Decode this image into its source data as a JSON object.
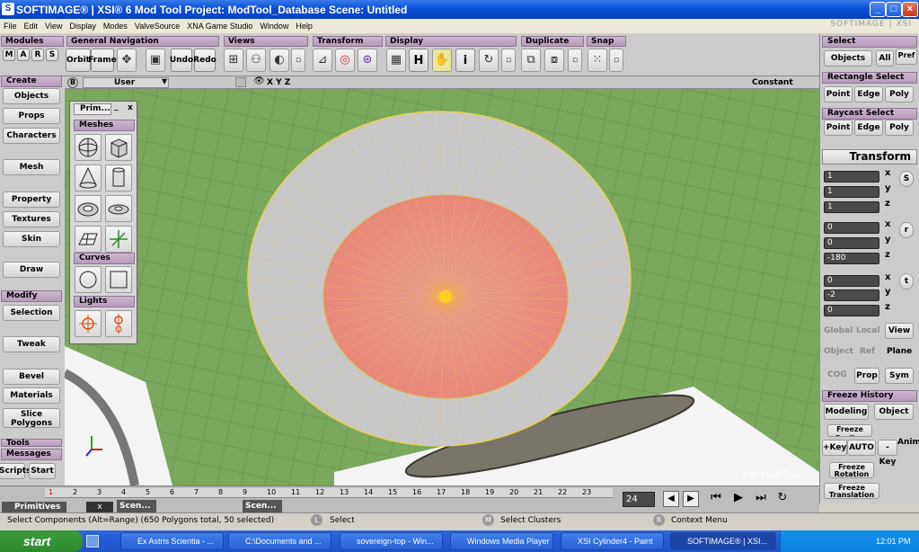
{
  "window": {
    "title": "SOFTIMAGE® | XSI® 6 Mod Tool Project: ModTool_Database     Scene: Untitled",
    "brand": "SOFTIMAGE | XSI"
  },
  "menu": [
    "File",
    "Edit",
    "View",
    "Display",
    "Modes",
    "ValveSource",
    "XNA Game Studio",
    "Window",
    "Help"
  ],
  "toolbar": {
    "modules": {
      "label": "Modules",
      "items": [
        "M",
        "A",
        "R",
        "S"
      ]
    },
    "general_nav": {
      "label": "General Navigation",
      "items": [
        "Orbit",
        "Frame"
      ]
    },
    "views": {
      "label": "Views"
    },
    "transform": {
      "label": "Transform",
      "undo": "Undo",
      "redo": "Redo"
    },
    "display": {
      "label": "Display",
      "h": "H",
      "i": "i"
    },
    "duplicate": {
      "label": "Duplicate"
    },
    "snap": {
      "label": "Snap"
    }
  },
  "left_panel": {
    "create_header": "Create",
    "create_items": [
      "Objects",
      "Props",
      "Characters",
      "Mesh",
      "Property",
      "Textures",
      "Skin",
      "Draw"
    ],
    "modify_header": "Modify",
    "modify_items": [
      "Selection",
      "Tweak",
      "Bevel",
      "Materials",
      "Slice Polygons"
    ],
    "tools_header": "Tools",
    "messages_header": "Messages",
    "bottom_items": [
      "Scripts",
      "Start"
    ]
  },
  "viewport_bar": {
    "b": "B",
    "camera": "User",
    "axes": "X  Y  Z",
    "mode": "Constant"
  },
  "primitives": {
    "title": "Prim...",
    "meshes": "Meshes",
    "curves": "Curves",
    "lights": "Lights"
  },
  "watermark": "XSI Mod Tool",
  "right_panel": {
    "select_header": "Select",
    "objects": "Objects",
    "all": "All",
    "pref": "Pref",
    "rect_select": "Rectangle Select",
    "raycast_select": "Raycast Select",
    "point": "Point",
    "edge": "Edge",
    "poly": "Poly",
    "transform_header": "Transform",
    "scale": [
      "1",
      "1",
      "1"
    ],
    "rotate": [
      "0",
      "0",
      "-180"
    ],
    "translate": [
      "0",
      "-2",
      "0"
    ],
    "axes": [
      "x",
      "y",
      "z"
    ],
    "srt": [
      "S",
      "r",
      "t"
    ],
    "global": "Global",
    "local": "Local",
    "view": "View",
    "object": "Object",
    "ref": "Ref",
    "plane": "Plane",
    "cog": "COG",
    "prop": "Prop",
    "sym": "Sym",
    "freeze_header": "Freeze History",
    "modeling": "Modeling",
    "object_btn": "Object",
    "freeze_scaling": "Freeze Scaling",
    "key": "+Key",
    "auto": "AUTO",
    "minus_key": "-Key",
    "anim": "Anim",
    "freeze_rotation": "Freeze Rotation",
    "freeze_translation": "Freeze Translation"
  },
  "timeline": {
    "frames": [
      "1",
      "2",
      "3",
      "4",
      "5",
      "6",
      "7",
      "8",
      "9",
      "10",
      "11",
      "12",
      "13",
      "14",
      "15",
      "16",
      "17",
      "18",
      "19",
      "20",
      "21",
      "22",
      "23"
    ],
    "current": "24",
    "primitives": "Primitives",
    "scene1": "Scen...",
    "scene2": "Scen..."
  },
  "status": {
    "message": "Select Components (Alt=Range) (650 Polygons total, 50 selected)",
    "l_label": "L",
    "l_text": "Select",
    "m_label": "M",
    "m_text": "Select Clusters",
    "r_label": "R",
    "r_text": "Context Menu"
  },
  "taskbar": {
    "start": "start",
    "tasks": [
      "Ex Astris Scientia - ...",
      "C:\\Documents and ...",
      "sovereign-top - Win...",
      "Windows Media Player",
      "XSI Cylinder4 - Paint",
      "SOFTIMAGE® | XSI..."
    ],
    "clock": "12:01 PM"
  }
}
